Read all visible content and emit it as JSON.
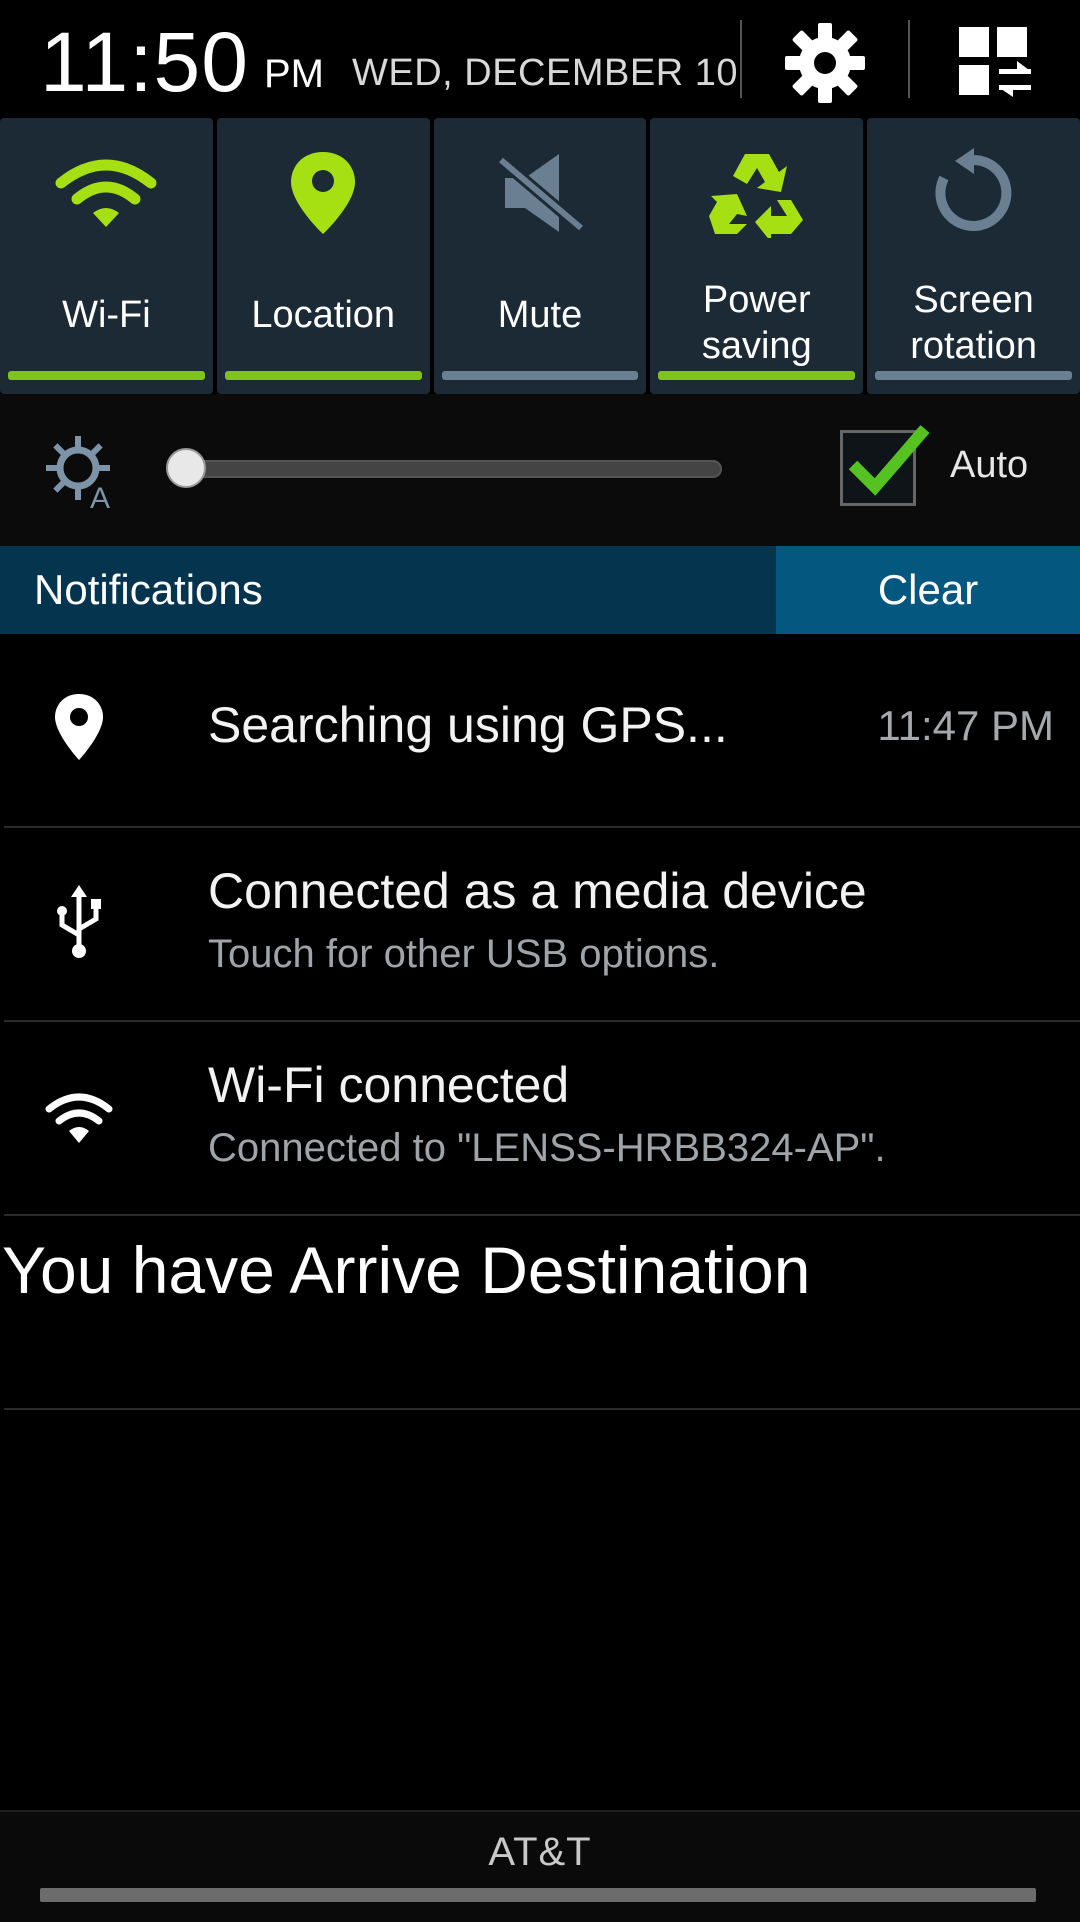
{
  "status": {
    "time": "11:50",
    "ampm": "PM",
    "date": "WED, DECEMBER 10",
    "settings_icon": "gear-icon",
    "edit_icon": "quick-settings-grid-icon"
  },
  "toggles": [
    {
      "label": "Wi-Fi",
      "icon": "wifi-icon",
      "state": "on"
    },
    {
      "label": "Location",
      "icon": "location-pin-icon",
      "state": "on"
    },
    {
      "label": "Mute",
      "icon": "mute-icon",
      "state": "off"
    },
    {
      "label": "Power\nsaving",
      "icon": "recycle-icon",
      "state": "on"
    },
    {
      "label": "Screen\nrotation",
      "icon": "rotation-icon",
      "state": "off"
    }
  ],
  "brightness": {
    "icon": "auto-brightness-icon",
    "level": 0.0,
    "auto_label": "Auto",
    "auto_checked": true
  },
  "notifications_header": {
    "title": "Notifications",
    "clear_label": "Clear"
  },
  "notifications": [
    {
      "icon": "location-pin-icon",
      "title": "Searching using GPS...",
      "time": "11:47 PM"
    },
    {
      "icon": "usb-icon",
      "title": "Connected as a media device",
      "subtitle": "Touch for other USB options."
    },
    {
      "icon": "wifi-icon",
      "title": "Wi-Fi connected",
      "subtitle": "Connected to \"LENSS-HRBB324-AP\"."
    },
    {
      "title": "You have Arrive Destination"
    }
  ],
  "footer": {
    "carrier": "AT&T"
  },
  "colors": {
    "accent_green": "#7fc31c",
    "tile_bg": "#1b2a35",
    "notif_header": "#05344e",
    "clear_button": "#04577f"
  }
}
